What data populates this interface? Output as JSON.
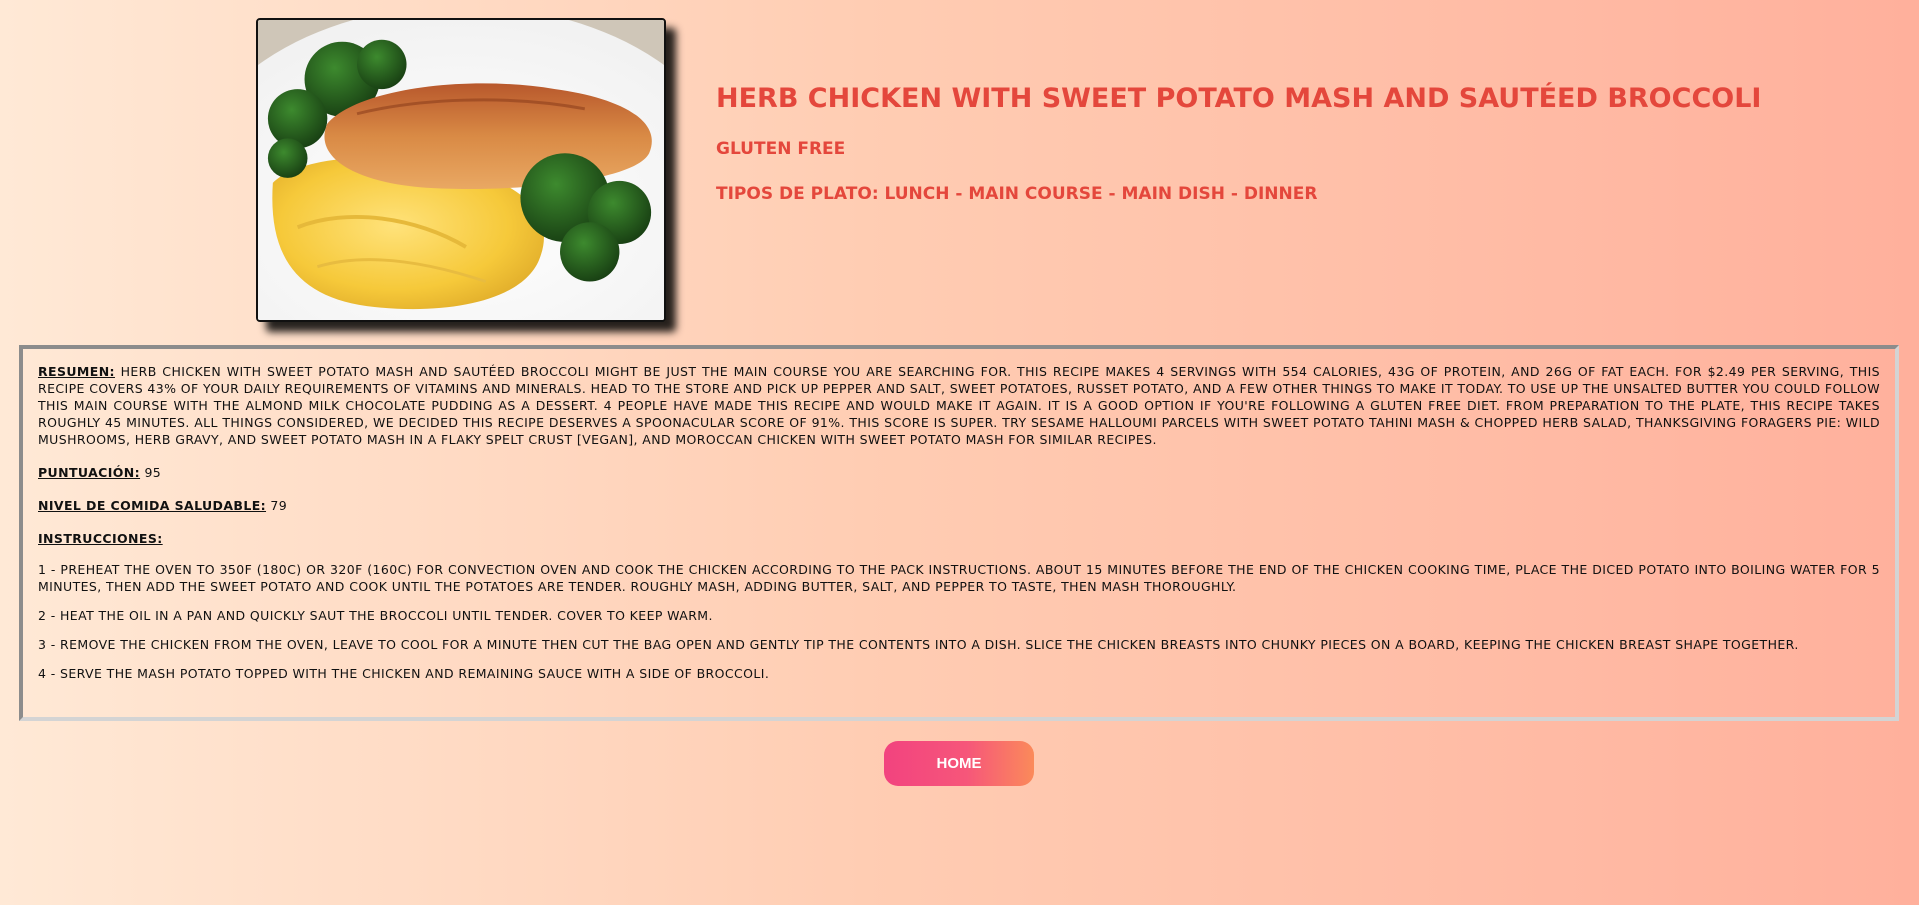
{
  "recipe": {
    "title": "HERB CHICKEN WITH SWEET POTATO MASH AND SAUTÉED BROCCOLI",
    "diet": "GLUTEN FREE",
    "dish_types": "TIPOS DE PLATO: LUNCH - MAIN COURSE - MAIN DISH - DINNER"
  },
  "summary": {
    "label": "RESUMEN:",
    "text": "HERB CHICKEN WITH SWEET POTATO MASH AND SAUTÉED BROCCOLI MIGHT BE JUST THE MAIN COURSE YOU ARE SEARCHING FOR. THIS RECIPE MAKES 4 SERVINGS WITH 554 CALORIES, 43G OF PROTEIN, AND 26G OF FAT EACH. FOR $2.49 PER SERVING, THIS RECIPE COVERS 43% OF YOUR DAILY REQUIREMENTS OF VITAMINS AND MINERALS. HEAD TO THE STORE AND PICK UP PEPPER AND SALT, SWEET POTATOES, RUSSET POTATO, AND A FEW OTHER THINGS TO MAKE IT TODAY. TO USE UP THE UNSALTED BUTTER YOU COULD FOLLOW THIS MAIN COURSE WITH THE ALMOND MILK CHOCOLATE PUDDING AS A DESSERT. 4 PEOPLE HAVE MADE THIS RECIPE AND WOULD MAKE IT AGAIN. IT IS A GOOD OPTION IF YOU'RE FOLLOWING A GLUTEN FREE DIET. FROM PREPARATION TO THE PLATE, THIS RECIPE TAKES ROUGHLY 45 MINUTES. ALL THINGS CONSIDERED, WE DECIDED THIS RECIPE DESERVES A SPOONACULAR SCORE OF 91%. THIS SCORE IS SUPER. TRY SESAME HALLOUMI PARCELS WITH SWEET POTATO TAHINI MASH & CHOPPED HERB SALAD, THANKSGIVING FORAGERS PIE: WILD MUSHROOMS, HERB GRAVY, AND SWEET POTATO MASH IN A FLAKY SPELT CRUST [VEGAN], AND MOROCCAN CHICKEN WITH SWEET POTATO MASH FOR SIMILAR RECIPES."
  },
  "score": {
    "label": "PUNTUACIÓN:",
    "value": "95"
  },
  "health": {
    "label": "NIVEL DE COMIDA SALUDABLE:",
    "value": "79"
  },
  "instructions": {
    "label": "INSTRUCCIONES:",
    "steps": [
      "1 - PREHEAT THE OVEN TO 350F (180C) OR 320F (160C) FOR CONVECTION OVEN AND COOK THE CHICKEN ACCORDING TO THE PACK INSTRUCTIONS. ABOUT 15 MINUTES BEFORE THE END OF THE CHICKEN COOKING TIME, PLACE THE DICED POTATO INTO BOILING WATER FOR 5 MINUTES, THEN ADD THE SWEET POTATO AND COOK UNTIL THE POTATOES ARE TENDER. ROUGHLY MASH, ADDING BUTTER, SALT, AND PEPPER TO TASTE, THEN MASH THOROUGHLY.",
      "2 - HEAT THE OIL IN A PAN AND QUICKLY SAUT THE BROCCOLI UNTIL TENDER. COVER TO KEEP WARM.",
      "3 - REMOVE THE CHICKEN FROM THE OVEN, LEAVE TO COOL FOR A MINUTE THEN CUT THE BAG OPEN AND GENTLY TIP THE CONTENTS INTO A DISH. SLICE THE CHICKEN BREASTS INTO CHUNKY PIECES ON A BOARD, KEEPING THE CHICKEN BREAST SHAPE TOGETHER.",
      "4 - SERVE THE MASH POTATO TOPPED WITH THE CHICKEN AND REMAINING SAUCE WITH A SIDE OF BROCCOLI."
    ]
  },
  "home_button": {
    "label": "HOME"
  },
  "colors": {
    "accent": "#e4473c",
    "button_start": "#f2437f",
    "button_end": "#fb8a5a"
  }
}
